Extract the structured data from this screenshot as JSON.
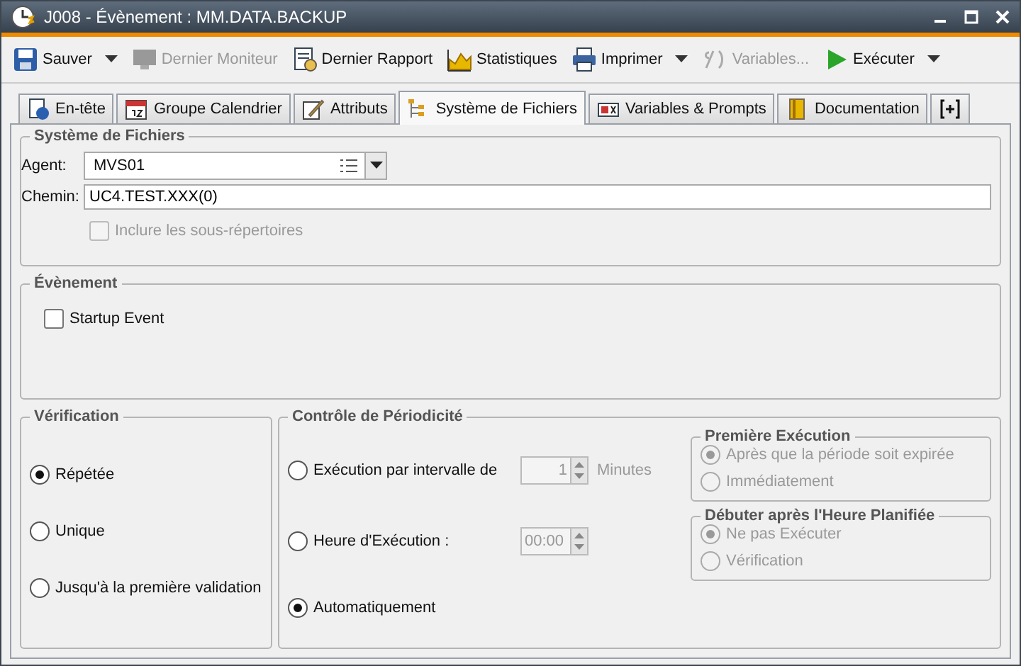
{
  "window": {
    "title": "J008 - Évènement : MM.DATA.BACKUP"
  },
  "toolbar": [
    {
      "label": "Sauver",
      "disabled": false,
      "menu": true
    },
    {
      "label": "Dernier Moniteur",
      "disabled": true,
      "menu": false
    },
    {
      "label": "Dernier Rapport",
      "disabled": false,
      "menu": false
    },
    {
      "label": "Statistiques",
      "disabled": false,
      "menu": false
    },
    {
      "label": "Imprimer",
      "disabled": false,
      "menu": true
    },
    {
      "label": "Variables...",
      "disabled": true,
      "menu": false
    },
    {
      "label": "Exécuter",
      "disabled": false,
      "menu": true
    }
  ],
  "tabs": [
    {
      "label": "En-tête",
      "selected": false
    },
    {
      "label": "Groupe Calendrier",
      "selected": false
    },
    {
      "label": "Attributs",
      "selected": false
    },
    {
      "label": "Système de Fichiers",
      "selected": true
    },
    {
      "label": "Variables & Prompts",
      "selected": false
    },
    {
      "label": "Documentation",
      "selected": false
    }
  ],
  "filesystem": {
    "title": "Système de Fichiers",
    "agent_label": "Agent:",
    "agent_value": "MVS01",
    "path_label": "Chemin:",
    "path_value": "UC4.TEST.XXX(0)",
    "subdirs": {
      "label": "Inclure les sous-répertoires",
      "checked": false,
      "disabled": true
    }
  },
  "event": {
    "title": "Évènement",
    "startup": {
      "label": "Startup Event",
      "checked": false
    }
  },
  "verification": {
    "title": "Vérification",
    "options": [
      {
        "label": "Répétée",
        "selected": true
      },
      {
        "label": "Unique",
        "selected": false
      },
      {
        "label": "Jusqu'à la première validation",
        "selected": false
      }
    ]
  },
  "periodicity": {
    "title": "Contrôle de Périodicité",
    "options": [
      {
        "kind": "interval",
        "label": "Exécution par intervalle de",
        "value": "1",
        "unit": "Minutes",
        "selected": false
      },
      {
        "kind": "time",
        "label": "Heure d'Exécution :",
        "value": "00:00",
        "selected": false
      },
      {
        "kind": "plain",
        "label": "Automatiquement",
        "selected": true
      }
    ],
    "first_execution": {
      "title": "Première Exécution",
      "disabled": true,
      "options": [
        {
          "label": "Après que la période soit expirée",
          "selected": true
        },
        {
          "label": "Immédiatement",
          "selected": false
        }
      ]
    },
    "start_after": {
      "title": "Débuter après l'Heure Planifiée",
      "disabled": true,
      "options": [
        {
          "label": "Ne pas Exécuter",
          "selected": true
        },
        {
          "label": "Vérification",
          "selected": false
        }
      ]
    }
  }
}
